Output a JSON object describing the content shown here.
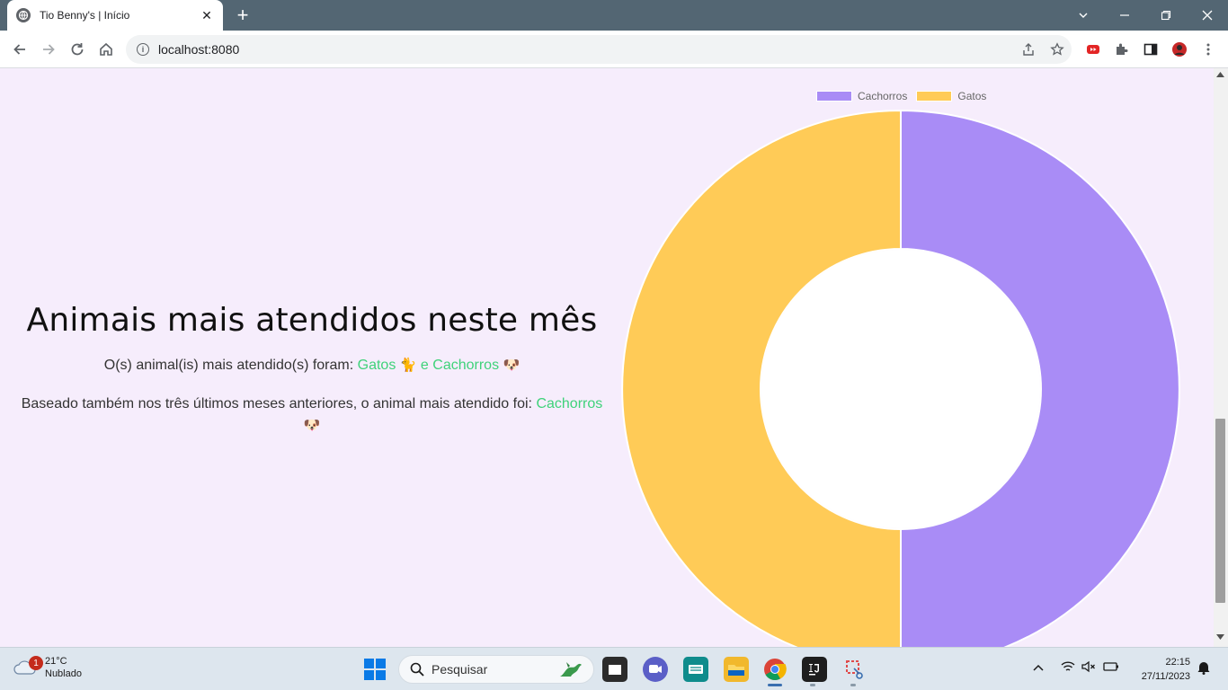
{
  "browser": {
    "tab_title": "Tio Benny's | Início",
    "url": "localhost:8080",
    "new_tab_symbol": "+",
    "close_symbol": "✕"
  },
  "content": {
    "headline": "Animais mais atendidos neste mês",
    "line1_prefix": "O(s) animal(is) mais atendido(s) foram:",
    "line1_animal1": "Gatos",
    "line1_emoji1": "🐈",
    "line1_animal2": "e Cachorros",
    "line1_emoji2": "🐶",
    "line2_prefix": "Baseado também nos três últimos meses anteriores, o animal mais atendido foi:",
    "line2_animal": "Cachorros",
    "line2_emoji": "🐶",
    "accent_color": "#3fd27a"
  },
  "chart_data": {
    "type": "doughnut",
    "labels": [
      "Cachorros",
      "Gatos"
    ],
    "values": [
      1,
      1
    ],
    "colors": [
      "#a98cf6",
      "#ffcb57"
    ],
    "legend_position": "top"
  },
  "taskbar": {
    "weather_temp": "21°C",
    "weather_desc": "Nublado",
    "weather_badge": "1",
    "search_placeholder": "Pesquisar",
    "time": "22:15",
    "date": "27/11/2023"
  }
}
